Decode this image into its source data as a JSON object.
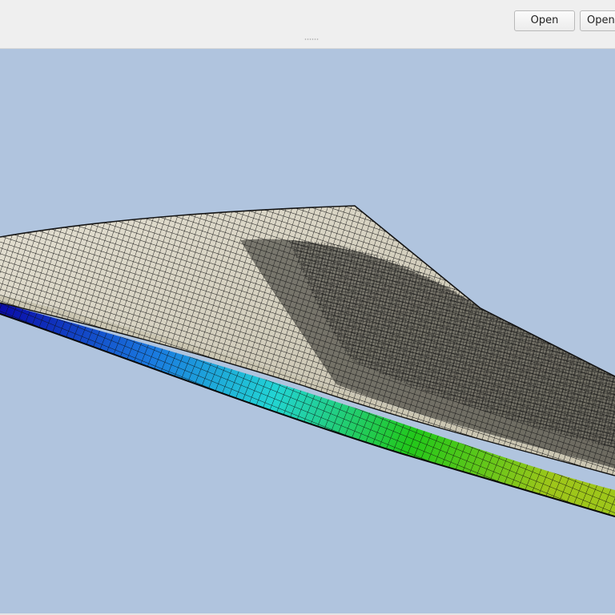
{
  "toolbar": {
    "buttons": [
      {
        "label": "Open"
      },
      {
        "label": "Open"
      }
    ]
  },
  "viewport": {
    "background_color": "#b0c4de",
    "model": {
      "upper_surface_color": "#d8d4c6",
      "mesh_line_color": "#1a1a1a",
      "lower_surface_gradient": [
        "#0a0aa8",
        "#1a7ae0",
        "#22d4d4",
        "#22c81a",
        "#9ec61a"
      ]
    }
  }
}
